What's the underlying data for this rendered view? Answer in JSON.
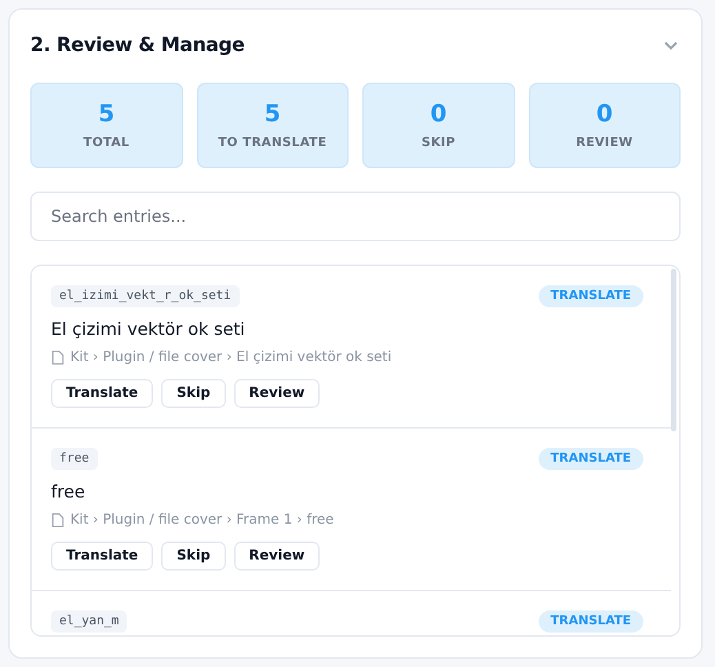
{
  "section": {
    "title": "2. Review & Manage",
    "expanded": true
  },
  "stats": [
    {
      "value": "5",
      "label": "TOTAL"
    },
    {
      "value": "5",
      "label": "TO TRANSLATE"
    },
    {
      "value": "0",
      "label": "SKIP"
    },
    {
      "value": "0",
      "label": "REVIEW"
    }
  ],
  "search": {
    "placeholder": "Search entries..."
  },
  "entries": [
    {
      "key": "el_izimi_vekt_r_ok_seti",
      "status": "TRANSLATE",
      "text": "El çizimi vektör ok seti",
      "path": "Kit › Plugin / file cover › El çizimi vektör ok seti",
      "actions": [
        "Translate",
        "Skip",
        "Review"
      ]
    },
    {
      "key": "free",
      "status": "TRANSLATE",
      "text": "free",
      "path": "Kit › Plugin / file cover › Frame 1 › free",
      "actions": [
        "Translate",
        "Skip",
        "Review"
      ]
    },
    {
      "key": "el_yan_m",
      "status": "TRANSLATE"
    }
  ]
}
